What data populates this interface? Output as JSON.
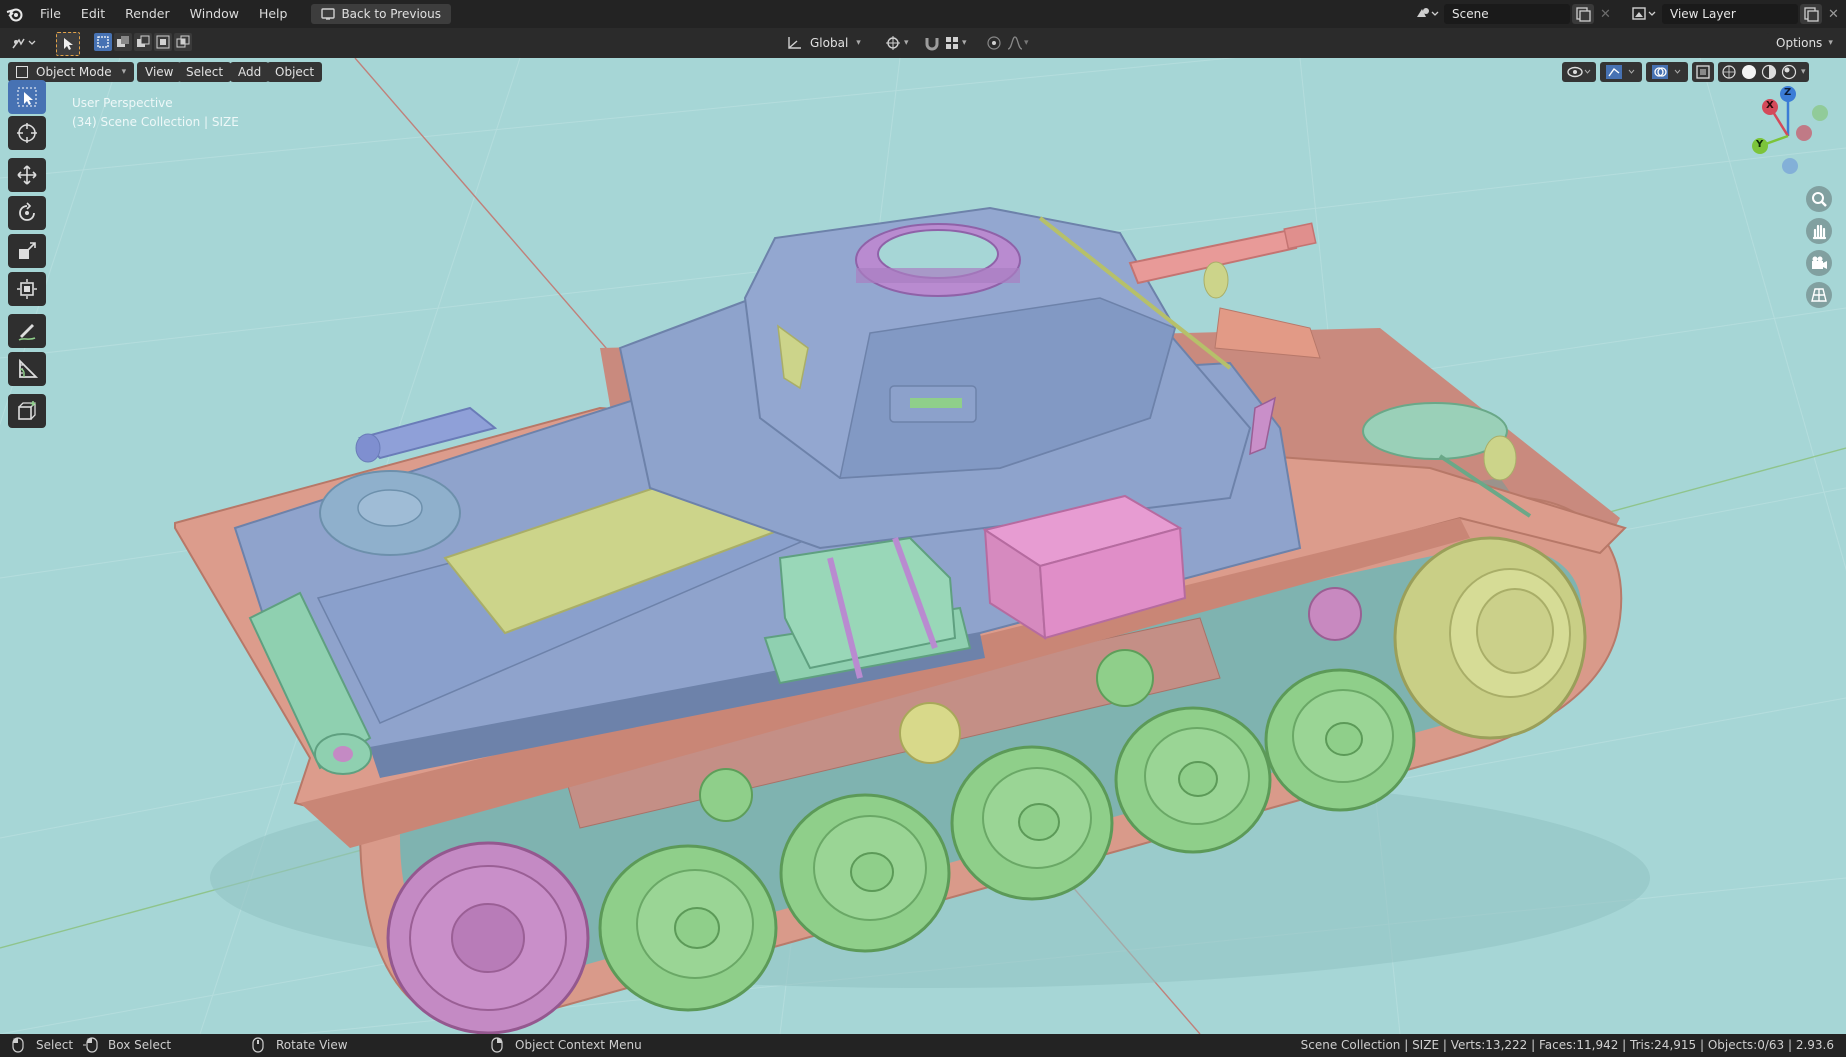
{
  "menu": {
    "file": "File",
    "edit": "Edit",
    "render": "Render",
    "window": "Window",
    "help": "Help",
    "back_button": "Back to Previous"
  },
  "top_right": {
    "scene_label": "Scene",
    "view_layer_label": "View Layer"
  },
  "toolbar": {
    "orientation": "Global",
    "options": "Options"
  },
  "viewport_header": {
    "mode": "Object Mode",
    "view": "View",
    "select": "Select",
    "add": "Add",
    "object": "Object"
  },
  "overlay_text": {
    "perspective": "User Perspective",
    "collection": "(34) Scene Collection | SIZE"
  },
  "gizmo": {
    "x": "X",
    "y": "Y",
    "z": "Z"
  },
  "statusbar": {
    "select": "Select",
    "box_select": "Box Select",
    "rotate_view": "Rotate View",
    "context_menu": "Object Context Menu",
    "stats": "Scene Collection | SIZE | Verts:13,222 | Faces:11,942 | Tris:24,915 | Objects:0/63 | 2.93.6"
  },
  "colors": {
    "viewport_bg": "#a6d6d6",
    "track": "#d99a8a",
    "hull": "#8fa3cc",
    "wheel": "#8fcf8a",
    "accent": "#4772b3"
  }
}
